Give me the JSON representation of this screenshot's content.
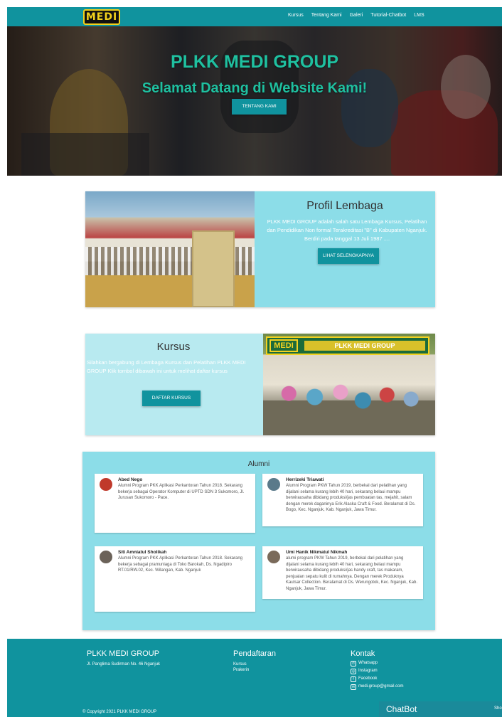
{
  "navbar": {
    "logo_text": "MEDI",
    "links": [
      "Kursus",
      "Tentang Kami",
      "Galeri",
      "Tutorial-Chatbot",
      "LMS"
    ]
  },
  "hero": {
    "title": "PLKK MEDI GROUP",
    "subtitle": "Selamat Datang di Website Kami!",
    "button": "TENTANG KAMI"
  },
  "profil": {
    "title": "Profil Lembaga",
    "text": "PLKK MEDI GROUP adalah salah satu Lembaga Kursus, Pelatihan dan Pendidikan Non formal Terakreditasi \"B\" di Kabupaten Nganjuk. Berdiri pada tanggal 13 Juli 1987 ....",
    "button": "LIHAT SELENGKAPNYA"
  },
  "kursus": {
    "title": "Kursus",
    "text": "Silahkan bergabung di Lembaga Kursus dan Pelatihan PLKK MEDI GROUP Klik tombol dibawah ini untuk melihat daftar kursus",
    "button": "DAFTAR KURSUS",
    "banner_logo": "MEDI",
    "banner_text": "PLKK MEDI GROUP"
  },
  "alumni": {
    "title": "Alumni",
    "items": [
      {
        "name": "Abed Nego",
        "desc": "Alumni Program PKK Aplikasi Perkantoran Tahun 2018. Sekarang bekerja sebagai Operator Komputer di UPTD SDN 3 Sukomoro, Jl. Jurusan Sukomoro - Pace."
      },
      {
        "name": "Herrizeki Triawati",
        "desc": "Alumni Program PKW Tahun 2019, berbekal dari pelatihan yang dijalani selama kurang lebih 40 hari, sekarang belaui mampu berwirausaha dibidang produksi/jas pembuatan tas, mejahit, salam dengan merek daganinya Erik Alaska Craft & Food. Beralamat di Ds. Bogo, Kec. Nganjuk, Kab. Nganjuk, Jawa Timur."
      },
      {
        "name": "Siti Amniatul Sholikah",
        "desc": "Alumni Program PKK Aplikasi Perkantoran Tahun 2018. Sekarang bekerja sebagai pramuniaga di Toko Barokah, Ds. Ngadipiro RT.01/RW.02, Kec. Wilangan, Kab. Nganjuk"
      },
      {
        "name": "Umi Hanik Nikmatul Nikmah",
        "desc": "alumi program PKW Tahun 2019, berbekal dari pelatihan yang dijalani selama kurang lebih 40 hari, sekarang belaui mampu berwirausaha dibidang produksi/jas handy craft, tas makaram, penjualan sepatu kulit di rumahnya. Dengan merek Produknya Kautsar Collection. Beralamat di Ds. Werungotok, Kec. Nganjuk, Kab. Nganjuk, Jawa Timur."
      }
    ]
  },
  "footer": {
    "brand": "PLKK MEDI GROUP",
    "address": "Jl. Panglima Sudirman No. 46 Nganjuk",
    "pendaftaran_title": "Pendaftaran",
    "pendaftaran_links": [
      "Kursus",
      "Prakerin"
    ],
    "kontak_title": "Kontak",
    "kontak": [
      "Whatsapp",
      "Instagram",
      "Facebook",
      "medi.group@gmail.com"
    ],
    "copyright": "© Copyright 2021 PLKK MEDI GROUP"
  },
  "chatbot": {
    "title": "ChatBot",
    "show": "Sho"
  },
  "colors": {
    "teal": "#10939e",
    "card_cyan": "#8cdde8",
    "hero_text": "#1fc0a0"
  }
}
